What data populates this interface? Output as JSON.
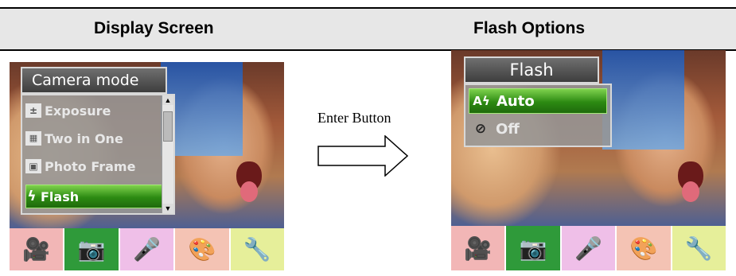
{
  "headers": {
    "left": "Display Screen",
    "right": "Flash Options"
  },
  "left_screen": {
    "menu_title": "Camera mode",
    "items": [
      {
        "label": "Exposure",
        "icon": "exposure-icon",
        "selected": false
      },
      {
        "label": "Two in One",
        "icon": "two-in-one-icon",
        "selected": false
      },
      {
        "label": "Photo Frame",
        "icon": "photo-frame-icon",
        "selected": false
      },
      {
        "label": "Flash",
        "icon": "flash-icon",
        "selected": true
      }
    ],
    "tabs": [
      {
        "icon": "video-camera-icon",
        "color": "#f2b6b6"
      },
      {
        "icon": "photo-camera-icon",
        "color": "#2f9a3a"
      },
      {
        "icon": "microphone-icon",
        "color": "#efbfe8"
      },
      {
        "icon": "palette-icon",
        "color": "#f4c3b4"
      },
      {
        "icon": "tools-icon",
        "color": "#e6ef9a"
      }
    ]
  },
  "middle": {
    "label": "Enter Button"
  },
  "right_screen": {
    "menu_title": "Flash",
    "options": [
      {
        "label": "Auto",
        "icon": "flash-auto-icon",
        "selected": true
      },
      {
        "label": "Off",
        "icon": "flash-off-icon",
        "selected": false
      }
    ],
    "tabs": [
      {
        "icon": "video-camera-icon",
        "color": "#f2b6b6"
      },
      {
        "icon": "photo-camera-icon",
        "color": "#2f9a3a"
      },
      {
        "icon": "microphone-icon",
        "color": "#efbfe8"
      },
      {
        "icon": "palette-icon",
        "color": "#f4c3b4"
      },
      {
        "icon": "tools-icon",
        "color": "#e6ef9a"
      }
    ]
  }
}
